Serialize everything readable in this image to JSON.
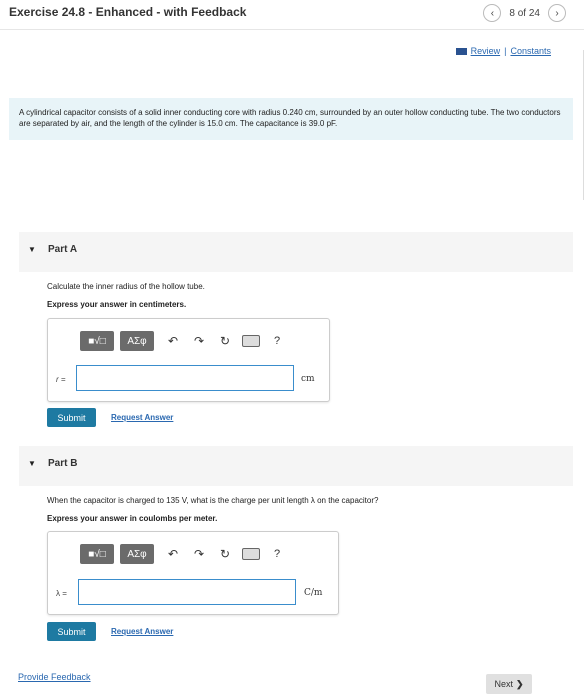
{
  "header": {
    "title": "Exercise 24.8 - Enhanced - with Feedback",
    "pager_text": "8 of 24",
    "prev_icon": "chevron-left-icon",
    "next_icon": "chevron-right-icon"
  },
  "links": {
    "review": "Review",
    "separator": "|",
    "constants": "Constants"
  },
  "problem": {
    "text": "A cylindrical capacitor consists of a solid inner conducting core with radius 0.240 cm, surrounded by an outer hollow conducting tube. The two conductors are separated by air, and the length of the cylinder is 15.0 cm. The capacitance is 39.0 pF."
  },
  "partA": {
    "label": "Part A",
    "question": "Calculate the inner radius of the hollow tube.",
    "instruction": "Express your answer in centimeters.",
    "variable": "r =",
    "unit": "cm",
    "input_value": "",
    "toolbar": {
      "templates": "■√□",
      "symbols": "ΑΣφ",
      "help": "?"
    },
    "submit": "Submit",
    "request": "Request Answer"
  },
  "partB": {
    "label": "Part B",
    "question": "When the capacitor is charged to 135 V, what is the charge per unit length λ on the capacitor?",
    "instruction": "Express your answer in coulombs per meter.",
    "variable": "λ =",
    "unit": "C/m",
    "input_value": "",
    "toolbar": {
      "templates": "■√□",
      "symbols": "ΑΣφ",
      "help": "?"
    },
    "submit": "Submit",
    "request": "Request Answer"
  },
  "footer": {
    "provide_feedback": "Provide Feedback",
    "next": "Next",
    "next_icon": "chevron-right-icon"
  },
  "colors": {
    "link": "#2a68b0",
    "submit_bg": "#1e7aa2",
    "problem_bg": "#e8f4f8",
    "toolbar_btn": "#6b6b6b",
    "input_border": "#3a8dcc"
  }
}
